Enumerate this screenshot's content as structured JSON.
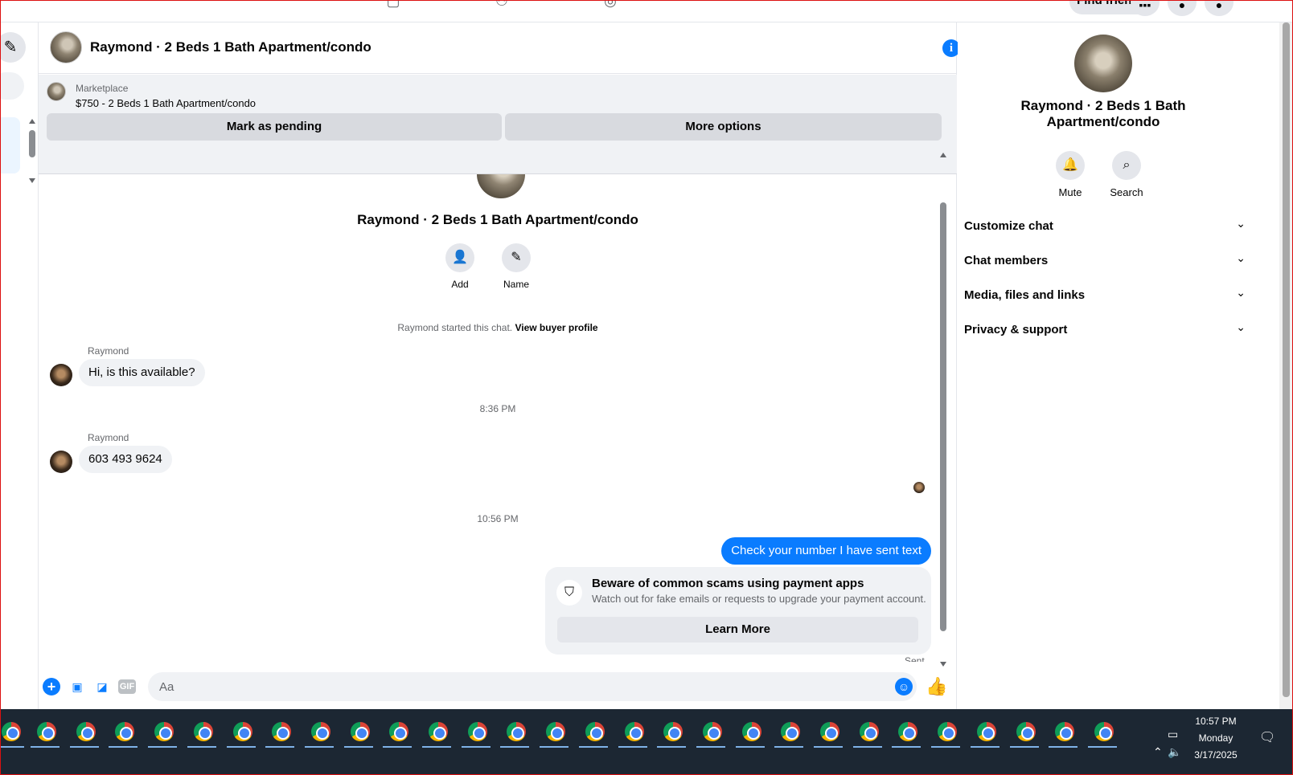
{
  "top": {
    "find_friends": "Find friends"
  },
  "chat": {
    "title": "Raymond · 2 Beds 1 Bath Apartment/condo",
    "marketplace_label": "Marketplace",
    "listing": "$750 - 2 Beds 1 Bath Apartment/condo",
    "mark_pending": "Mark as pending",
    "more_options": "More options",
    "thread_title": "Raymond · 2 Beds 1 Bath Apartment/condo",
    "actions": [
      {
        "label": "Add",
        "icon": "add-person-icon"
      },
      {
        "label": "Name",
        "icon": "pencil-icon"
      }
    ],
    "started_text": "Raymond started this chat.",
    "view_buyer": "View buyer profile",
    "messages": [
      {
        "sender": "Raymond",
        "text": "Hi, is this available?"
      },
      {
        "time": "8:36 PM"
      },
      {
        "sender": "Raymond",
        "text": "603 493 9624"
      },
      {
        "time": "10:56 PM"
      },
      {
        "outgoing": true,
        "text": "Check your number I have sent text"
      }
    ],
    "scam_title": "Beware of common scams using payment apps",
    "scam_sub": "Watch out for fake emails or requests to upgrade your payment account.",
    "learn_more": "Learn More",
    "sent": "Sent",
    "composer_placeholder": "Aa",
    "gif": "GIF",
    "accent": "#0a7cff"
  },
  "info_panel": {
    "title": "Raymond · 2 Beds 1 Bath Apartment/condo",
    "actions": [
      {
        "label": "Mute",
        "icon": "bell-icon"
      },
      {
        "label": "Search",
        "icon": "search-icon"
      }
    ],
    "sections": [
      "Customize chat",
      "Chat members",
      "Media, files and links",
      "Privacy & support"
    ]
  },
  "taskbar": {
    "time": "10:57 PM",
    "day": "Monday",
    "date": "3/17/2025",
    "app_count": 29
  }
}
